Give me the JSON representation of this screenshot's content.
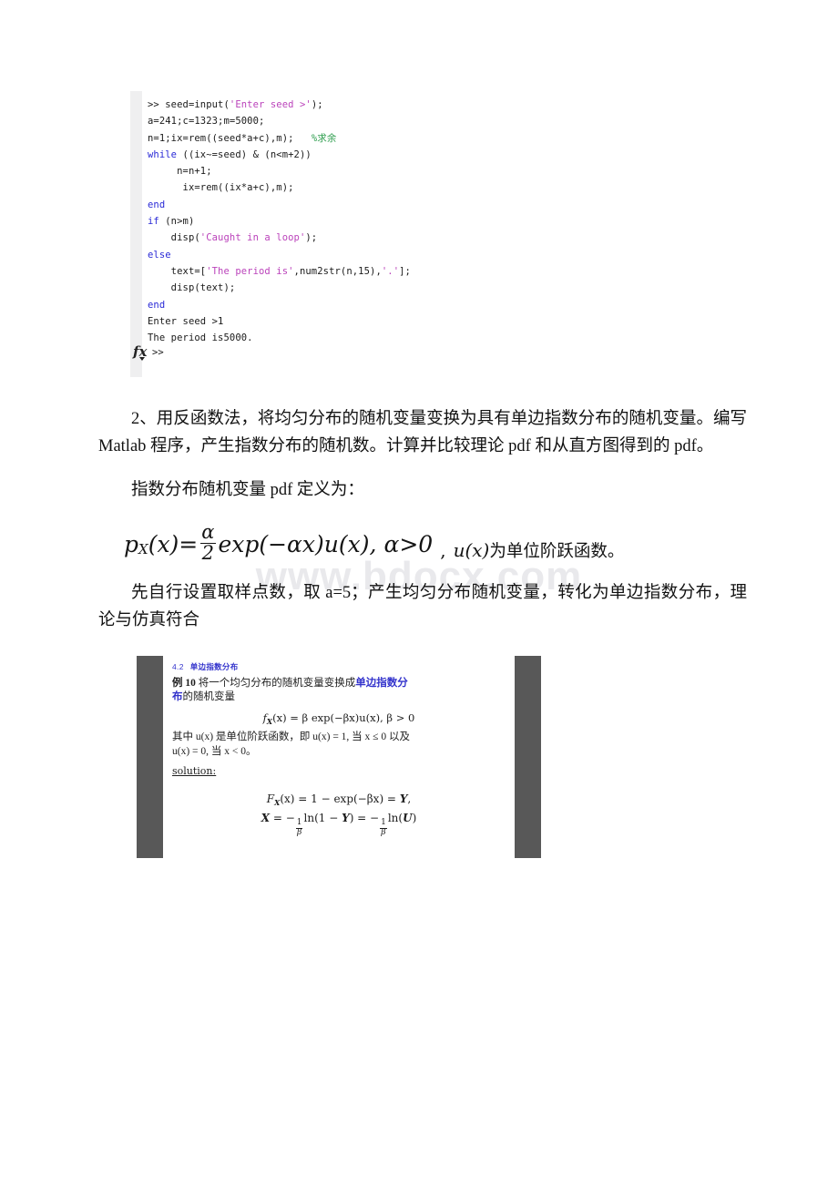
{
  "page": {
    "watermark": "www.bdocx.com"
  },
  "code_block": {
    "name": "matlab-console-transcript",
    "prompt_symbol": ">>",
    "fx_icon_label": "fx",
    "lines": [
      [
        {
          "t": ">> ",
          "c": "prompt"
        },
        {
          "t": "seed=input(",
          "c": "plain"
        },
        {
          "t": "'Enter seed >'",
          "c": "str"
        },
        {
          "t": ");",
          "c": "plain"
        }
      ],
      [
        {
          "t": "a=241;c=1323;m=5000;",
          "c": "plain"
        }
      ],
      [
        {
          "t": "n=1;ix=rem((seed*a+c),m);   ",
          "c": "plain"
        },
        {
          "t": "%求余",
          "c": "cmt"
        }
      ],
      [
        {
          "t": "while",
          "c": "kw"
        },
        {
          "t": " ((ix~=seed) & (n<m+2))",
          "c": "plain"
        }
      ],
      [
        {
          "t": "     n=n+1;",
          "c": "plain"
        }
      ],
      [
        {
          "t": "      ix=rem((ix*a+c),m);",
          "c": "plain"
        }
      ],
      [
        {
          "t": "end",
          "c": "kw"
        }
      ],
      [
        {
          "t": "if",
          "c": "kw"
        },
        {
          "t": " (n>m)",
          "c": "plain"
        }
      ],
      [
        {
          "t": "    disp(",
          "c": "plain"
        },
        {
          "t": "'Caught in a loop'",
          "c": "str"
        },
        {
          "t": ");",
          "c": "plain"
        }
      ],
      [
        {
          "t": "else",
          "c": "kw"
        }
      ],
      [
        {
          "t": "    text=[",
          "c": "plain"
        },
        {
          "t": "'The period is'",
          "c": "str"
        },
        {
          "t": ",num2str(n,15),",
          "c": "plain"
        },
        {
          "t": "'.'",
          "c": "str"
        },
        {
          "t": "];",
          "c": "plain"
        }
      ],
      [
        {
          "t": "    disp(text);",
          "c": "plain"
        }
      ],
      [
        {
          "t": "end",
          "c": "kw"
        }
      ],
      [
        {
          "t": "Enter seed >1",
          "c": "plain"
        }
      ],
      [
        {
          "t": "The period is5000.",
          "c": "plain"
        }
      ]
    ]
  },
  "body": {
    "question_2": "2、用反函数法，将均匀分布的随机变量变换为具有单边指数分布的随机变量。编写 Matlab 程序，产生指数分布的随机数。计算并比较理论 pdf 和从直方图得到的 pdf。",
    "pdf_definition_lead": "指数分布随机变量 pdf 定义为：",
    "note": "先自行设置取样点数，取 a=5；产生均匀分布随机变量，转化为单边指数分布，理论与仿真符合"
  },
  "formula": {
    "lhs": "p",
    "lhs_sub": "X",
    "lhs_arg": "(x)=",
    "frac_num": "α",
    "frac_den": "2",
    "body": "exp(−αx)u(x),",
    "condition": "α>0",
    "comma": ",",
    "tail_math": "u(x)",
    "tail_cn": "为单位阶跃函数。"
  },
  "slide": {
    "section_number": "4.2",
    "section_title": "单边指数分布",
    "example_label": "例 10",
    "example_text_1": "将一个均匀分布的随机变量变换成",
    "example_highlight_1": "单边指数分",
    "example_highlight_2": "布",
    "example_text_2": "的随机变量",
    "equation_1": {
      "fx": "f",
      "fx_sub": "X",
      "rest": "(x) = β exp(−βx)u(x), β > 0"
    },
    "condition_line_1": "其中 u(x) 是单位阶跃函数，即 u(x) = 1, 当 x ≤ 0 以及",
    "condition_line_2": "u(x) = 0, 当 x < 0。",
    "solution_label": "solution:",
    "solution_eq_1": {
      "f": "F",
      "f_sub": "X",
      "rest": "(x) = 1 − exp(−βx) = ",
      "y": "Y",
      "comma": ","
    },
    "solution_eq_2": {
      "x": "X",
      "eq": " = −",
      "num1": "1",
      "den1": "β",
      "ln1": "ln(1 − ",
      "y": "Y",
      "close1": ") = −",
      "num2": "1",
      "den2": "β",
      "ln2": "ln(",
      "u": "U",
      "close2": ")"
    }
  }
}
